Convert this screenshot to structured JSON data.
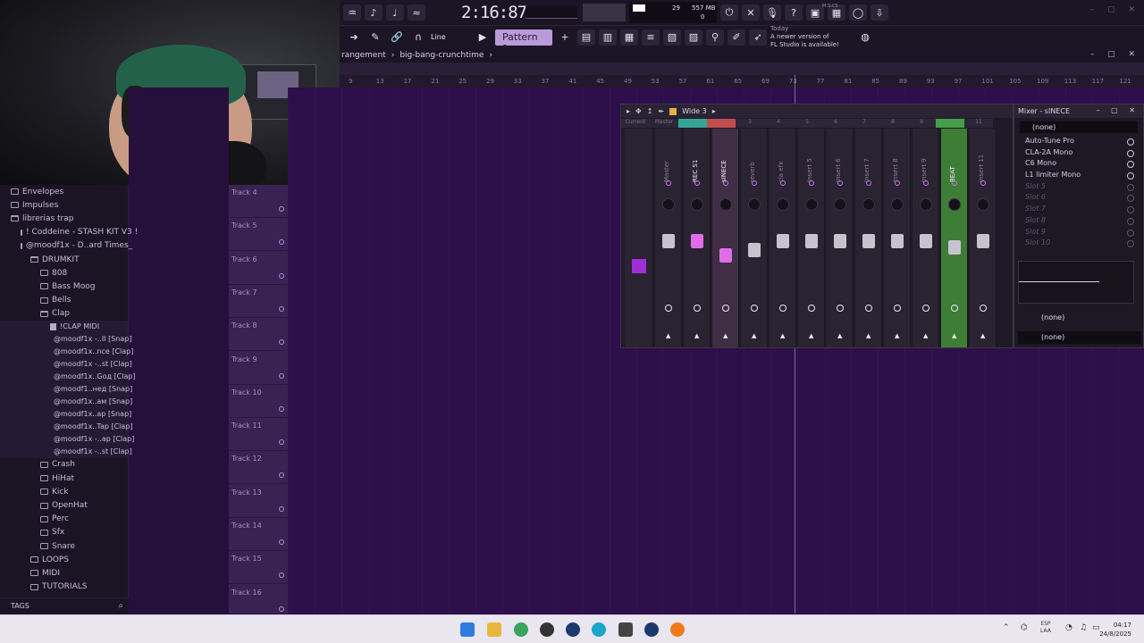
{
  "toolbar": {
    "time": "2:16:87",
    "time_sub": "M:S:CS",
    "cpu_mem": "557 MB",
    "cpu_poly": "0",
    "cpu_val": "29",
    "snap": "Line",
    "pattern": "Pattern 1",
    "hint_title": "Today",
    "hint_line1": "A newer version of",
    "hint_line2": "FL Studio is available!"
  },
  "playlist": {
    "breadcrumb1": "rangement",
    "breadcrumb2": "big-bang-crunchtime"
  },
  "ruler": [
    "9",
    "13",
    "17",
    "21",
    "25",
    "29",
    "33",
    "37",
    "41",
    "45",
    "49",
    "53",
    "57",
    "61",
    "65",
    "69",
    "73",
    "77",
    "81",
    "85",
    "89",
    "93",
    "97",
    "101",
    "105",
    "109",
    "113",
    "117",
    "121"
  ],
  "browser": {
    "items": [
      {
        "label": "Envelopes",
        "indent": 0,
        "type": "folder"
      },
      {
        "label": "Impulses",
        "indent": 0,
        "type": "folder"
      },
      {
        "label": "librerias trap",
        "indent": 0,
        "type": "folder-open"
      },
      {
        "label": "! Coddeine - STASH KIT V3 !",
        "indent": 1,
        "type": "folder"
      },
      {
        "label": "@moodf1x - D..ard Times_",
        "indent": 1,
        "type": "folder-open"
      },
      {
        "label": "DRUMKIT",
        "indent": 2,
        "type": "folder-open"
      },
      {
        "label": "808",
        "indent": 3,
        "type": "folder"
      },
      {
        "label": "Bass Moog",
        "indent": 3,
        "type": "folder"
      },
      {
        "label": "Bells",
        "indent": 3,
        "type": "folder"
      },
      {
        "label": "Clap",
        "indent": 3,
        "type": "folder-open"
      },
      {
        "label": "!CLAP MIDI",
        "indent": 4,
        "type": "file"
      },
      {
        "label": "@moodf1x -..II [Snap]",
        "indent": 4,
        "type": "file"
      },
      {
        "label": "@moodf1x..nce [Clap]",
        "indent": 4,
        "type": "file"
      },
      {
        "label": "@moodf1x -..st [Clap]",
        "indent": 4,
        "type": "file"
      },
      {
        "label": "@moodf1x..Goд [Clap]",
        "indent": 4,
        "type": "file"
      },
      {
        "label": "@moodf1..нед [Snap]",
        "indent": 4,
        "type": "file"
      },
      {
        "label": "@moodf1x..aм [Snap]",
        "indent": 4,
        "type": "file"
      },
      {
        "label": "@moodf1x..ap [Snap]",
        "indent": 4,
        "type": "file"
      },
      {
        "label": "@moodf1x..Tap [Clap]",
        "indent": 4,
        "type": "file"
      },
      {
        "label": "@moodf1x -..ap [Clap]",
        "indent": 4,
        "type": "file"
      },
      {
        "label": "@moodf1x -..st [Clap]",
        "indent": 4,
        "type": "file"
      },
      {
        "label": "Crash",
        "indent": 3,
        "type": "folder"
      },
      {
        "label": "HiHat",
        "indent": 3,
        "type": "folder"
      },
      {
        "label": "Kick",
        "indent": 3,
        "type": "folder"
      },
      {
        "label": "OpenHat",
        "indent": 3,
        "type": "folder"
      },
      {
        "label": "Perc",
        "indent": 3,
        "type": "folder"
      },
      {
        "label": "Sfx",
        "indent": 3,
        "type": "folder"
      },
      {
        "label": "Snare",
        "indent": 3,
        "type": "folder"
      },
      {
        "label": "LOOPS",
        "indent": 2,
        "type": "folder"
      },
      {
        "label": "MIDI",
        "indent": 2,
        "type": "folder"
      },
      {
        "label": "TUTORIALS",
        "indent": 2,
        "type": "folder"
      }
    ],
    "footer": "TAGS"
  },
  "tracks": [
    "Track 4",
    "Track 5",
    "Track 6",
    "Track 7",
    "Track 8",
    "Track 9",
    "Track 10",
    "Track 11",
    "Track 12",
    "Track 13",
    "Track 14",
    "Track 15",
    "Track 16"
  ],
  "mixer": {
    "preset": "Wide 3",
    "title": "Mixer - sINECE",
    "tabs": [
      "Current",
      "Master",
      "1",
      "2",
      "3",
      "4",
      "5",
      "6",
      "7",
      "8",
      "9",
      "10",
      "11"
    ],
    "strips": [
      {
        "name": "Master",
        "hi": false
      },
      {
        "name": "REC S1",
        "hi": true
      },
      {
        "name": "sINECE",
        "hi": true
      },
      {
        "name": "reverb",
        "hi": false
      },
      {
        "name": "cla efx",
        "hi": false
      },
      {
        "name": "Insert 5",
        "hi": false
      },
      {
        "name": "Insert 6",
        "hi": false
      },
      {
        "name": "Insert 7",
        "hi": false
      },
      {
        "name": "Insert 8",
        "hi": false
      },
      {
        "name": "Insert 9",
        "hi": false
      },
      {
        "name": "BEAT",
        "hi": true
      },
      {
        "name": "Insert 11",
        "hi": false
      }
    ],
    "slot_selector": "(none)",
    "slots": [
      {
        "label": "Auto-Tune Pro",
        "dim": false
      },
      {
        "label": "CLA-2A Mono",
        "dim": false
      },
      {
        "label": "C6 Mono",
        "dim": false
      },
      {
        "label": "L1 limiter Mono",
        "dim": false
      },
      {
        "label": "Slot 5",
        "dim": true
      },
      {
        "label": "Slot 6",
        "dim": true
      },
      {
        "label": "Slot 7",
        "dim": true
      },
      {
        "label": "Slot 8",
        "dim": true
      },
      {
        "label": "Slot 9",
        "dim": true
      },
      {
        "label": "Slot 10",
        "dim": true
      }
    ],
    "out1": "(none)",
    "out2": "(none)"
  },
  "taskbar": {
    "lang1": "ESP",
    "lang2": "LAA",
    "time": "04:17",
    "date": "24/8/2025"
  }
}
